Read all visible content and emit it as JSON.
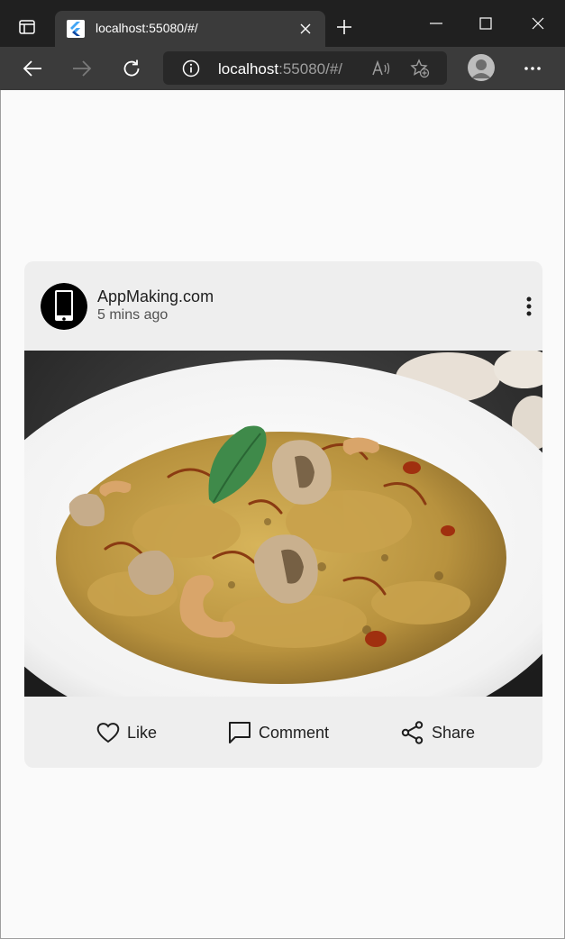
{
  "browser": {
    "tab_title": "localhost:55080/#/",
    "address_host": "localhost",
    "address_rest": ":55080/#/"
  },
  "post": {
    "author": "AppMaking.com",
    "time": "5 mins ago",
    "actions": {
      "like": "Like",
      "comment": "Comment",
      "share": "Share"
    }
  },
  "colors": {
    "chrome_dark": "#202020",
    "toolbar": "#3b3b3b",
    "page_bg": "#fafafa",
    "card_bg": "#eeeeee"
  }
}
